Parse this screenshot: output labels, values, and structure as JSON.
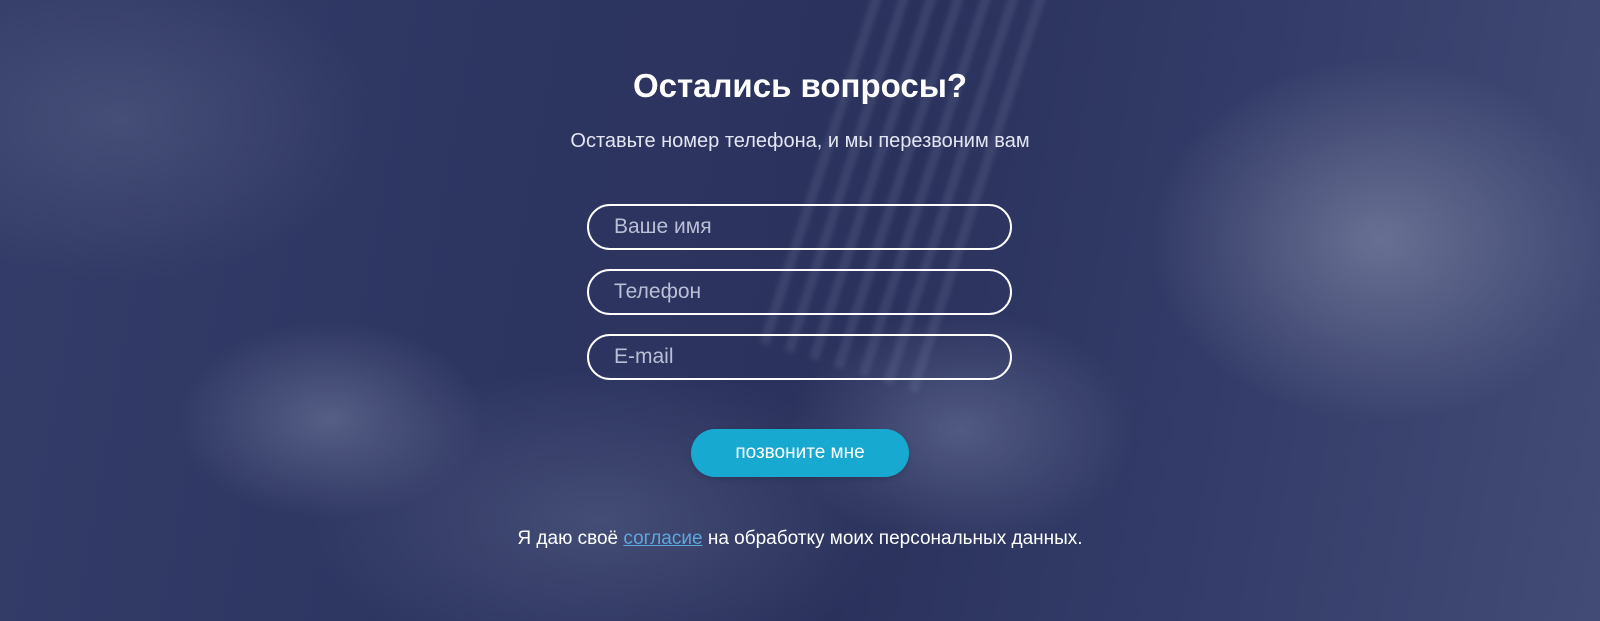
{
  "section": {
    "title": "Остались вопросы?",
    "subtitle": "Оставьте номер телефона, и мы перезвоним вам"
  },
  "form": {
    "name_placeholder": "Ваше имя",
    "phone_placeholder": "Телефон",
    "email_placeholder": "E-mail",
    "submit_label": "позвоните мне"
  },
  "consent": {
    "before": "Я даю своё ",
    "link": "согласие",
    "after": " на обработку моих персональных данных."
  },
  "colors": {
    "button": "#18a9d0",
    "link": "#5fa6dc",
    "overlay": "#343d66"
  }
}
